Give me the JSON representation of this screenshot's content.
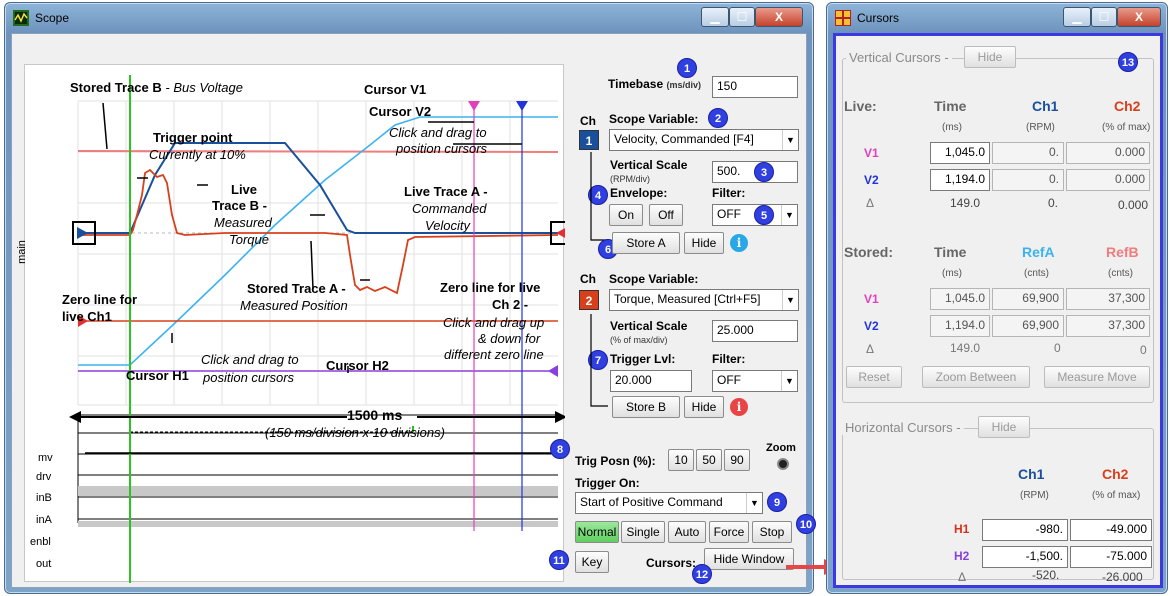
{
  "scope_window": {
    "title": "Scope",
    "timebase_label": "Timebase",
    "timebase_unit": "(ms/div)",
    "timebase_value": "150",
    "ch_header": "Ch",
    "ch1": {
      "number": "1",
      "scope_variable_label": "Scope Variable:",
      "scope_variable_value": "Velocity, Commanded [F4]",
      "vertical_scale_label": "Vertical Scale",
      "vertical_scale_unit": "(RPM/div)",
      "vertical_scale_value": "500.",
      "envelope_label": "Envelope:",
      "on_label": "On",
      "off_label": "Off",
      "filter_label": "Filter:",
      "filter_value": "OFF",
      "store_label": "Store A",
      "hide_label": "Hide"
    },
    "ch2": {
      "number": "2",
      "scope_variable_label": "Scope Variable:",
      "scope_variable_value": "Torque, Measured [Ctrl+F5]",
      "vertical_scale_label": "Vertical Scale",
      "vertical_scale_unit": "(% of max/div)",
      "vertical_scale_value": "25.000",
      "trigger_lvl_label": "Trigger Lvl:",
      "trigger_lvl_value": "20.000",
      "filter_label": "Filter:",
      "filter_value": "OFF",
      "store_label": "Store B",
      "hide_label": "Hide"
    },
    "trig_posn_label": "Trig Posn (%):",
    "trig_posn_options": [
      "10",
      "50",
      "90"
    ],
    "zoom_label": "Zoom",
    "trigger_on_label": "Trigger On:",
    "trigger_on_value": "Start of Positive Command",
    "mode_buttons": [
      "Normal",
      "Single",
      "Auto",
      "Force",
      "Stop"
    ],
    "key_label": "Key",
    "cursors_label": "Cursors:",
    "hide_window_label": "Hide Window",
    "plot_side_label": "main",
    "digital_labels": [
      "mv",
      "drv",
      "inB",
      "inA",
      "enbl",
      "out"
    ],
    "annotations": {
      "stored_b_bold": "Stored Trace B",
      "stored_b_rest": " - Bus Voltage",
      "cursor_v1": "Cursor V1",
      "cursor_v2": "Cursor V2",
      "click_drag_1": "Click and drag to",
      "click_drag_2": "position cursors",
      "trigger_point": "Trigger point",
      "trigger_currently": "Currently at 10%",
      "live_b_1": "Live",
      "live_b_2": "Trace B -",
      "live_b_3": "Measured",
      "live_b_4": "Torque",
      "live_a_1": "Live Trace A -",
      "live_a_2": "Commanded",
      "live_a_3": "Velocity",
      "stored_a_1": "Stored Trace A -",
      "stored_a_2": "Measured Position",
      "zero_ch1_1": "Zero line for",
      "zero_ch1_2": "live Ch1",
      "zero_ch2_1": "Zero line for live",
      "zero_ch2_2": "Ch 2 -",
      "zero_ch2_3": "Click and drag up",
      "zero_ch2_4": "& down for",
      "zero_ch2_5": "different zero line",
      "cursor_h1": "Cursor H1",
      "h_click_1": "Click and drag to",
      "h_click_2": "position cursors",
      "cursor_h2": "Cursor H2",
      "span_ms": "1500 ms",
      "span_note": "(150 ms/division x 10 divisions)"
    },
    "badges": [
      "1",
      "2",
      "3",
      "4",
      "5",
      "6",
      "7",
      "8",
      "9",
      "10",
      "11",
      "12",
      "13"
    ]
  },
  "cursors_window": {
    "title": "Cursors",
    "vertical_group": "Vertical Cursors -",
    "hide_label": "Hide",
    "live": {
      "label": "Live:",
      "col_time": "Time",
      "col_time_unit": "(ms)",
      "col_ch1": "Ch1",
      "col_ch1_unit": "(RPM)",
      "col_ch2": "Ch2",
      "col_ch2_unit": "(% of max)",
      "rows": [
        {
          "name": "V1",
          "time": "1,045.0",
          "ch1": "0.",
          "ch2": "0.000"
        },
        {
          "name": "V2",
          "time": "1,194.0",
          "ch1": "0.",
          "ch2": "0.000"
        },
        {
          "name": "Δ",
          "time": "149.0",
          "ch1": "0.",
          "ch2": "0.000"
        }
      ]
    },
    "stored": {
      "label": "Stored:",
      "col_time": "Time",
      "col_time_unit": "(ms)",
      "col_a": "RefA",
      "col_a_unit": "(cnts)",
      "col_b": "RefB",
      "col_b_unit": "(cnts)",
      "rows": [
        {
          "name": "V1",
          "time": "1,045.0",
          "a": "69,900",
          "b": "37,300"
        },
        {
          "name": "V2",
          "time": "1,194.0",
          "a": "69,900",
          "b": "37,300"
        },
        {
          "name": "Δ",
          "time": "149.0",
          "a": "0",
          "b": "0"
        }
      ]
    },
    "actions": [
      "Reset",
      "Zoom Between",
      "Measure Move"
    ],
    "horizontal_group": "Horizontal Cursors -",
    "horizontal": {
      "col_ch1": "Ch1",
      "col_ch1_unit": "(RPM)",
      "col_ch2": "Ch2",
      "col_ch2_unit": "(% of max)",
      "rows": [
        {
          "name": "H1",
          "ch1": "-980.",
          "ch2": "-49.000"
        },
        {
          "name": "H2",
          "ch1": "-1,500.",
          "ch2": "-75.000"
        },
        {
          "name": "Δ",
          "ch1": "-520.",
          "ch2": "-26.000"
        }
      ]
    }
  },
  "colors": {
    "ch1": "#1a4f9c",
    "ch2": "#d8401c",
    "refA": "#3cb3f0",
    "refB": "#ee7d7d",
    "trigger": "#29c41f",
    "cursor_v1": "#e23fbc",
    "cursor_v2": "#2233dd",
    "badge": "#2f3fe0",
    "highlight": "#3a3ae0"
  }
}
